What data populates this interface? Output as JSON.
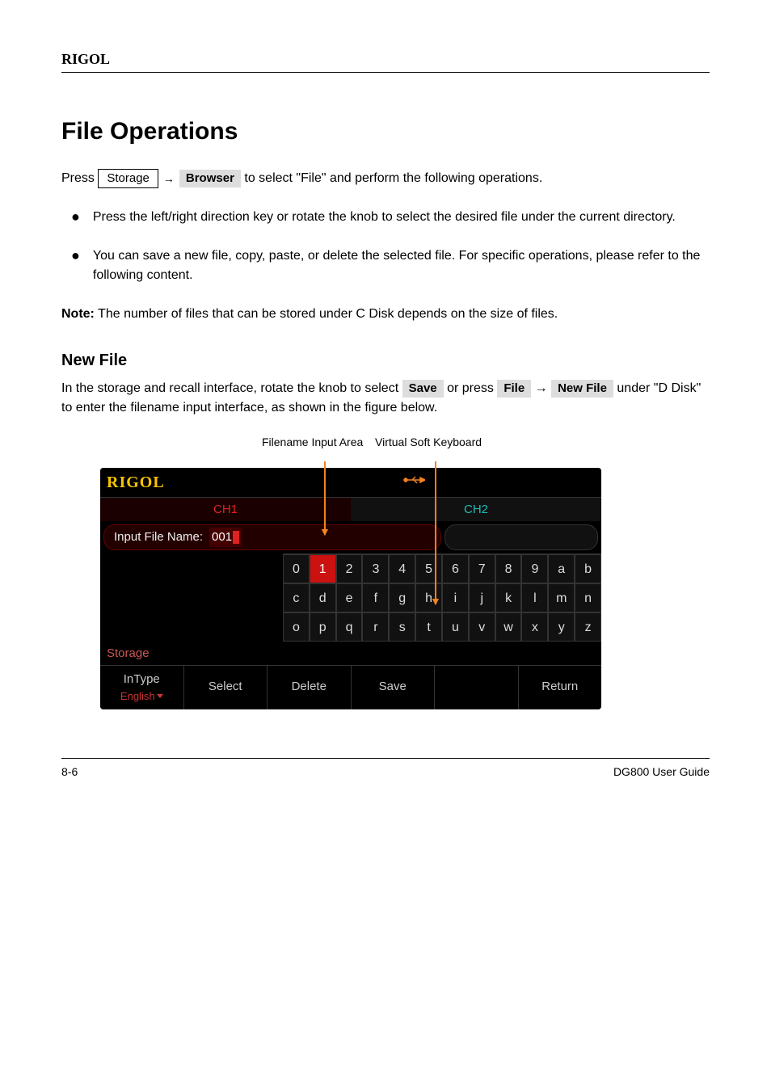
{
  "header": {
    "brand": "RIGOL"
  },
  "title": "File Operations",
  "intro_prefix": "Press ",
  "breadcrumb": {
    "key": "Storage",
    "arrow": "→",
    "soft": "Browser"
  },
  "intro_suffix": " to select \"File\" and perform the following operations.",
  "bullets": [
    "Press the left/right direction key or rotate the knob to select the desired file under the current directory.",
    "You can save a new file, copy, paste, or delete the selected file. For specific operations, please refer to the following content."
  ],
  "note_label": "Note:",
  "note_body": " The number of files that can be stored under C Disk depends on the size of files.",
  "sub_title": "New File",
  "save_para_1": "In the storage and recall interface, rotate the knob to select ",
  "save_soft1": "Save",
  "save_para_2": " or press ",
  "save_soft2": "File",
  "save_para_3": " → ",
  "save_soft3": "New File",
  "save_para_4": " under \"D Disk\" to enter the filename input interface, as shown in the figure below.",
  "callouts": {
    "a": "Filename Input Area",
    "b": "Virtual Soft Keyboard"
  },
  "screenshot": {
    "logo": "RIGOL",
    "ch1": "CH1",
    "ch2": "CH2",
    "fn_label": "Input File Name:",
    "fn_value": "001",
    "keys_rows": [
      [
        "0",
        "1",
        "2",
        "3",
        "4",
        "5",
        "6",
        "7",
        "8",
        "9",
        "a",
        "b"
      ],
      [
        "c",
        "d",
        "e",
        "f",
        "g",
        "h",
        "i",
        "j",
        "k",
        "l",
        "m",
        "n"
      ],
      [
        "o",
        "p",
        "q",
        "r",
        "s",
        "t",
        "u",
        "v",
        "w",
        "x",
        "y",
        "z"
      ]
    ],
    "selected_key": "1",
    "status": "Storage",
    "menu": [
      {
        "top": "InType",
        "sub": "English"
      },
      {
        "top": "Select"
      },
      {
        "top": "Delete"
      },
      {
        "top": "Save"
      },
      {
        "top": ""
      },
      {
        "top": "Return"
      }
    ]
  },
  "footer": {
    "left": "8-6",
    "right": "DG800 User Guide"
  }
}
